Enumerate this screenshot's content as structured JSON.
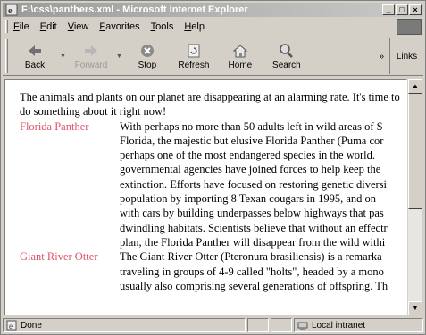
{
  "window": {
    "title": "F:\\css\\panthers.xml - Microsoft Internet Explorer",
    "controls": [
      "_",
      "□",
      "×"
    ]
  },
  "menu": [
    "File",
    "Edit",
    "View",
    "Favorites",
    "Tools",
    "Help"
  ],
  "toolbar": {
    "back": "Back",
    "forward": "Forward",
    "stop": "Stop",
    "refresh": "Refresh",
    "home": "Home",
    "search": "Search",
    "links": "Links",
    "chevron": "»"
  },
  "content": {
    "intro": "The animals and plants on our planet are disappearing at an alarming rate. It's time to do something about it right now!",
    "animals": [
      {
        "name": "Florida Panther",
        "lines": [
          "With perhaps no more than 50 adults left in wild areas of S",
          "Florida, the majestic but elusive Florida Panther (Puma cor",
          "perhaps one of the most endangered species in the world.",
          "governmental agencies have joined forces to help keep the",
          "extinction. Efforts have focused on restoring genetic diversi",
          "population by importing 8 Texan cougars in 1995, and on",
          "with cars by building underpasses below highways that pas",
          "dwindling habitats. Scientists believe that without an effectr",
          "plan, the Florida Panther will disappear from the wild withi"
        ]
      },
      {
        "name": "Giant River Otter",
        "lines": [
          "The Giant River Otter (Pteronura brasiliensis) is a remarka",
          "traveling in groups of 4-9 called \"holts\", headed by a mono",
          "usually also comprising several generations of offspring. Th"
        ]
      }
    ]
  },
  "status": {
    "text": "Done",
    "zone": "Local intranet"
  }
}
